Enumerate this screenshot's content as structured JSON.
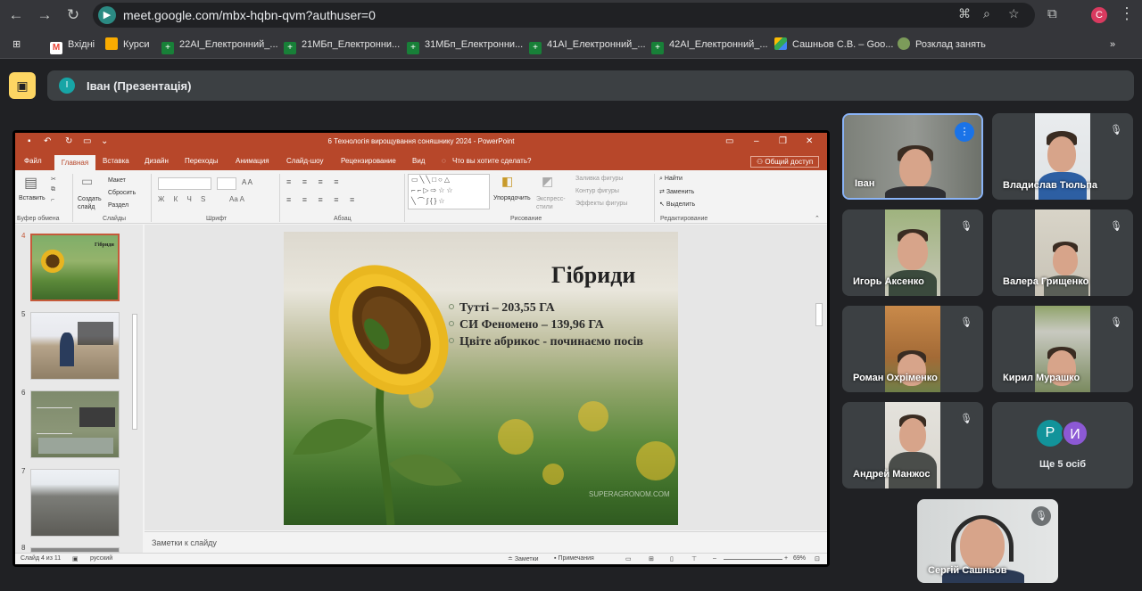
{
  "browser": {
    "url": "meet.google.com/mbx-hqbn-qvm?authuser=0",
    "profile_initial": "С",
    "bookmarks": [
      {
        "label": "Вхідні",
        "icon": "gmail-icon",
        "color": "#ea4335"
      },
      {
        "label": "Курси",
        "icon": "classroom-icon",
        "color": "#f9ab00"
      },
      {
        "label": "22АІ_Електронний_...",
        "icon": "sheets-icon",
        "color": "#188038"
      },
      {
        "label": "21МБп_Електронни...",
        "icon": "sheets-icon",
        "color": "#188038"
      },
      {
        "label": "31МБп_Електронни...",
        "icon": "sheets-icon",
        "color": "#188038"
      },
      {
        "label": "41АІ_Електронний_...",
        "icon": "sheets-icon",
        "color": "#188038"
      },
      {
        "label": "42АІ_Електронний_...",
        "icon": "sheets-icon",
        "color": "#188038"
      },
      {
        "label": "Сашньов С.В. – Goo...",
        "icon": "drive-icon",
        "color": "#4285f4"
      },
      {
        "label": "Розклад занять",
        "icon": "site-icon",
        "color": "#7c9b5a"
      }
    ]
  },
  "meet": {
    "presenter_initial": "І",
    "presenter_label": "Іван (Презентація)",
    "more_people": "Ще 5 осіб",
    "more_avatars": [
      "Р",
      "И"
    ],
    "participants": [
      {
        "name": "Іван",
        "state": "speaking"
      },
      {
        "name": "Владислав Тюльпа",
        "state": "muted"
      },
      {
        "name": "Игорь Аксенко",
        "state": "muted"
      },
      {
        "name": "Валера Грищенко",
        "state": "muted"
      },
      {
        "name": "Роман Охріменко",
        "state": "muted"
      },
      {
        "name": "Кирил Мурашко",
        "state": "muted"
      },
      {
        "name": "Андрей Манжос",
        "state": "muted"
      },
      {
        "name": "Сергій Сашньов",
        "state": "muted"
      }
    ]
  },
  "ppt": {
    "title": "6 Технологія вирощування соняшнику 2024 - PowerPoint",
    "tabs": [
      "Файл",
      "Главная",
      "Вставка",
      "Дизайн",
      "Переходы",
      "Анимация",
      "Слайд-шоу",
      "Рецензирование",
      "Вид"
    ],
    "tell_me": "Что вы хотите сделать?",
    "share": "Общий доступ",
    "ribbon": {
      "paste": "Вставить",
      "clipboard": "Буфер обмена",
      "new_slide": "Создать слайд",
      "layout": "Макет",
      "reset": "Сбросить",
      "section": "Раздел",
      "slides": "Слайды",
      "font": "Шрифт",
      "paragraph": "Абзац",
      "arrange": "Упорядочить",
      "quick_styles": "Экспресс-стили",
      "shape_fill": "Заливка фигуры",
      "shape_outline": "Контур фигуры",
      "shape_effects": "Эффекты фигуры",
      "drawing": "Рисование",
      "find": "Найти",
      "replace": "Заменить",
      "select": "Выделить",
      "editing": "Редактирование"
    },
    "thumb_numbers": [
      "4",
      "5",
      "6",
      "7",
      "8"
    ],
    "thumb4_title": "Гібриди",
    "slide": {
      "title": "Гібриди",
      "bullets": [
        "Тутті – 203,55 ГА",
        "СИ Феномено – 139,96 ГА",
        "Цвіте абрикос - починаємо посів"
      ],
      "watermark": "SUPERAGRONOM.COM"
    },
    "notes_placeholder": "Заметки к слайду",
    "status": {
      "slide_info": "Слайд 4 из 11",
      "language": "русский",
      "notes": "Заметки",
      "comments": "Примечания",
      "zoom": "69%"
    }
  }
}
